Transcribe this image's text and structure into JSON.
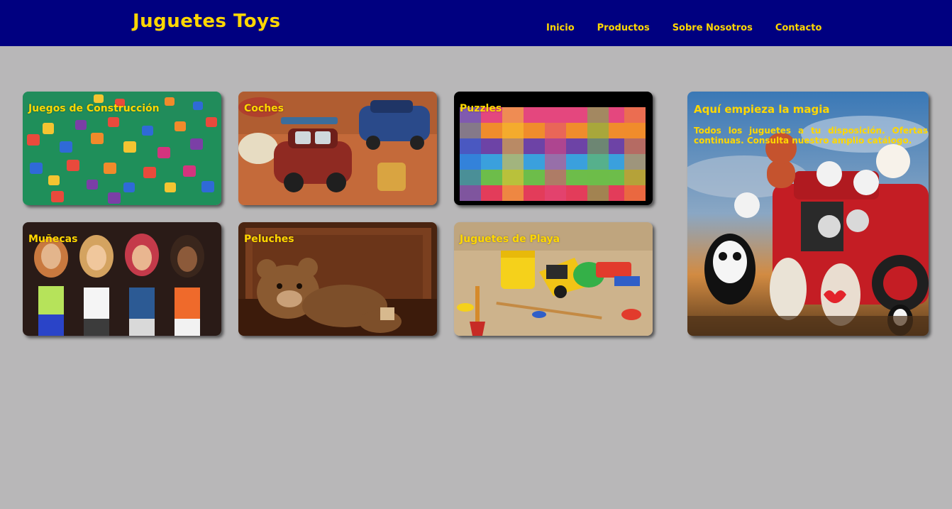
{
  "brand": {
    "name": "Juguetes Toys"
  },
  "nav": {
    "items": [
      {
        "label": "Inicio"
      },
      {
        "label": "Productos"
      },
      {
        "label": "Sobre Nosotros"
      },
      {
        "label": "Contacto"
      }
    ]
  },
  "categories": [
    {
      "title": "Juegos de Construcción",
      "image": "wooden-blocks-image"
    },
    {
      "title": "Coches",
      "image": "toy-cars-image"
    },
    {
      "title": "Puzzles",
      "image": "puzzle-pieces-image"
    },
    {
      "title": "Muñecas",
      "image": "dolls-image"
    },
    {
      "title": "Peluches",
      "image": "teddy-bear-image"
    },
    {
      "title": "Juguetes de Playa",
      "image": "beach-toys-image"
    }
  ],
  "feature": {
    "title": "Aquí empieza la magia",
    "description": "Todos los juguetes a tu disposición. Ofertas continuas. Consulta nuestro amplio catálogo.",
    "image": "plush-toys-fire-truck-image"
  },
  "colors": {
    "header_bg": "#000080",
    "accent_text": "#ffd700",
    "page_bg": "#b8b7b8"
  }
}
